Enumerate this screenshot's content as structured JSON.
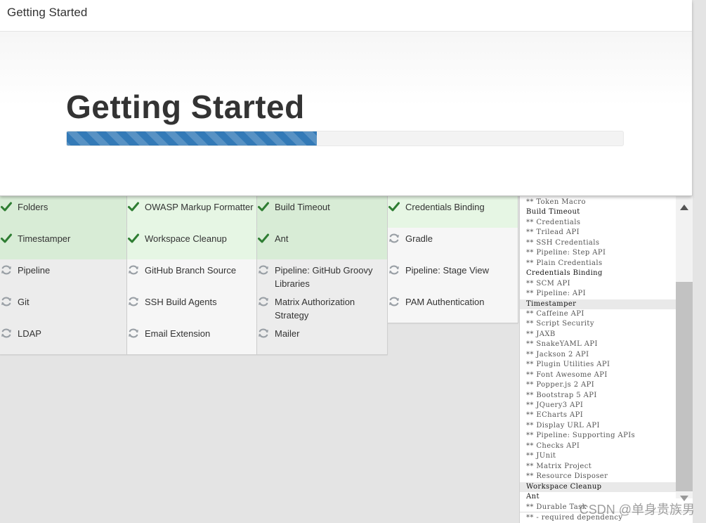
{
  "window": {
    "title": "Getting Started"
  },
  "hero": {
    "title": "Getting Started",
    "progress_percent": 45
  },
  "colors": {
    "accent": "#337ab7",
    "success_icon": "#2e7d32",
    "pending_icon": "#9aa0a6"
  },
  "plugins": [
    {
      "name": "Folders",
      "status": "success",
      "icon": "check-icon"
    },
    {
      "name": "OWASP Markup Formatter",
      "status": "success",
      "icon": "check-icon"
    },
    {
      "name": "Build Timeout",
      "status": "success",
      "icon": "check-icon"
    },
    {
      "name": "Credentials Binding",
      "status": "success",
      "icon": "check-icon"
    },
    {
      "name": "Timestamper",
      "status": "success",
      "icon": "check-icon"
    },
    {
      "name": "Workspace Cleanup",
      "status": "success",
      "icon": "check-icon"
    },
    {
      "name": "Ant",
      "status": "success",
      "icon": "check-icon"
    },
    {
      "name": "Gradle",
      "status": "pending",
      "icon": "refresh-icon"
    },
    {
      "name": "Pipeline",
      "status": "pending",
      "icon": "refresh-icon"
    },
    {
      "name": "GitHub Branch Source",
      "status": "pending",
      "icon": "refresh-icon"
    },
    {
      "name": "Pipeline: GitHub Groovy Libraries",
      "status": "pending",
      "icon": "refresh-icon"
    },
    {
      "name": "Pipeline: Stage View",
      "status": "pending",
      "icon": "refresh-icon"
    },
    {
      "name": "Git",
      "status": "pending",
      "icon": "refresh-icon"
    },
    {
      "name": "SSH Build Agents",
      "status": "pending",
      "icon": "refresh-icon"
    },
    {
      "name": "Matrix Authorization Strategy",
      "status": "pending",
      "icon": "refresh-icon"
    },
    {
      "name": "PAM Authentication",
      "status": "pending",
      "icon": "refresh-icon"
    },
    {
      "name": "LDAP",
      "status": "pending",
      "icon": "refresh-icon"
    },
    {
      "name": "Email Extension",
      "status": "pending",
      "icon": "refresh-icon"
    },
    {
      "name": "Mailer",
      "status": "pending",
      "icon": "refresh-icon"
    }
  ],
  "log": {
    "lines": [
      {
        "text": "** Token Macro",
        "type": "dep"
      },
      {
        "text": "Build Timeout",
        "type": "top"
      },
      {
        "text": "** Credentials",
        "type": "dep"
      },
      {
        "text": "** Trilead API",
        "type": "dep"
      },
      {
        "text": "** SSH Credentials",
        "type": "dep"
      },
      {
        "text": "** Pipeline: Step API",
        "type": "dep"
      },
      {
        "text": "** Plain Credentials",
        "type": "dep"
      },
      {
        "text": "Credentials Binding",
        "type": "top"
      },
      {
        "text": "** SCM API",
        "type": "dep"
      },
      {
        "text": "** Pipeline: API",
        "type": "dep"
      },
      {
        "text": "Timestamper",
        "type": "top",
        "highlight": true
      },
      {
        "text": "** Caffeine API",
        "type": "dep"
      },
      {
        "text": "** Script Security",
        "type": "dep"
      },
      {
        "text": "** JAXB",
        "type": "dep"
      },
      {
        "text": "** SnakeYAML API",
        "type": "dep"
      },
      {
        "text": "** Jackson 2 API",
        "type": "dep"
      },
      {
        "text": "** Plugin Utilities API",
        "type": "dep"
      },
      {
        "text": "** Font Awesome API",
        "type": "dep"
      },
      {
        "text": "** Popper.js 2 API",
        "type": "dep"
      },
      {
        "text": "** Bootstrap 5 API",
        "type": "dep"
      },
      {
        "text": "** JQuery3 API",
        "type": "dep"
      },
      {
        "text": "** ECharts API",
        "type": "dep"
      },
      {
        "text": "** Display URL API",
        "type": "dep"
      },
      {
        "text": "** Pipeline: Supporting APIs",
        "type": "dep"
      },
      {
        "text": "** Checks API",
        "type": "dep"
      },
      {
        "text": "** JUnit",
        "type": "dep"
      },
      {
        "text": "** Matrix Project",
        "type": "dep"
      },
      {
        "text": "** Resource Disposer",
        "type": "dep"
      },
      {
        "text": "Workspace Cleanup",
        "type": "top",
        "highlight": true
      },
      {
        "text": "Ant",
        "type": "top"
      },
      {
        "text": "** Durable Task",
        "type": "dep"
      }
    ],
    "footer": "** - required dependency"
  },
  "watermark": "CSDN @单身贵族男"
}
